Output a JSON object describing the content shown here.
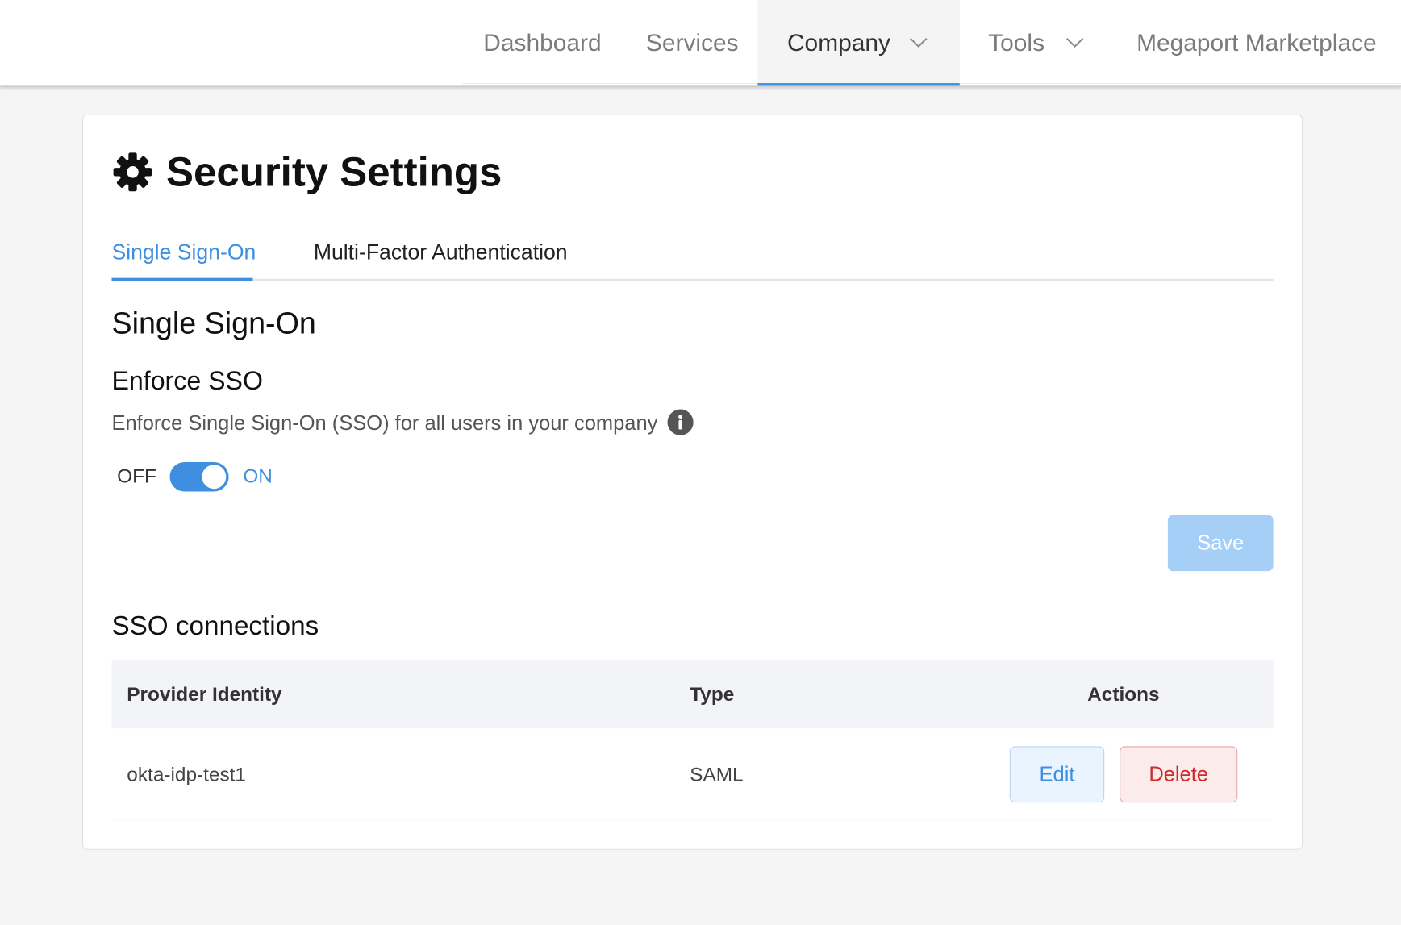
{
  "nav": {
    "items": [
      {
        "label": "Dashboard",
        "active": false,
        "has_dropdown": false
      },
      {
        "label": "Services",
        "active": false,
        "has_dropdown": false
      },
      {
        "label": "Company",
        "active": true,
        "has_dropdown": true,
        "icon": "chevron-down-icon"
      },
      {
        "label": "Tools",
        "active": false,
        "has_dropdown": true,
        "icon": "chevron-down-icon"
      },
      {
        "label": "Megaport Marketplace",
        "active": false,
        "has_dropdown": false
      }
    ]
  },
  "page": {
    "title": "Security Settings",
    "title_icon": "gear-icon"
  },
  "tabs": [
    {
      "label": "Single Sign-On",
      "active": true
    },
    {
      "label": "Multi-Factor Authentication",
      "active": false
    }
  ],
  "sso": {
    "heading": "Single Sign-On",
    "enforce": {
      "title": "Enforce SSO",
      "description": "Enforce Single Sign-On (SSO) for all users in your company",
      "info_icon": "info-icon",
      "toggle": {
        "off_label": "OFF",
        "on_label": "ON",
        "value": true
      }
    },
    "save_label": "Save",
    "save_enabled": false
  },
  "connections": {
    "heading": "SSO connections",
    "columns": [
      "Provider Identity",
      "Type",
      "Actions"
    ],
    "rows": [
      {
        "provider_identity": "okta-idp-test1",
        "type": "SAML",
        "actions": {
          "edit_label": "Edit",
          "delete_label": "Delete"
        }
      }
    ]
  },
  "colors": {
    "accent": "#3e8fe0",
    "save_disabled": "#a5cff7",
    "danger": "#d02a2a",
    "edit_bg": "#eaf4fe",
    "delete_bg": "#fcebeb"
  }
}
